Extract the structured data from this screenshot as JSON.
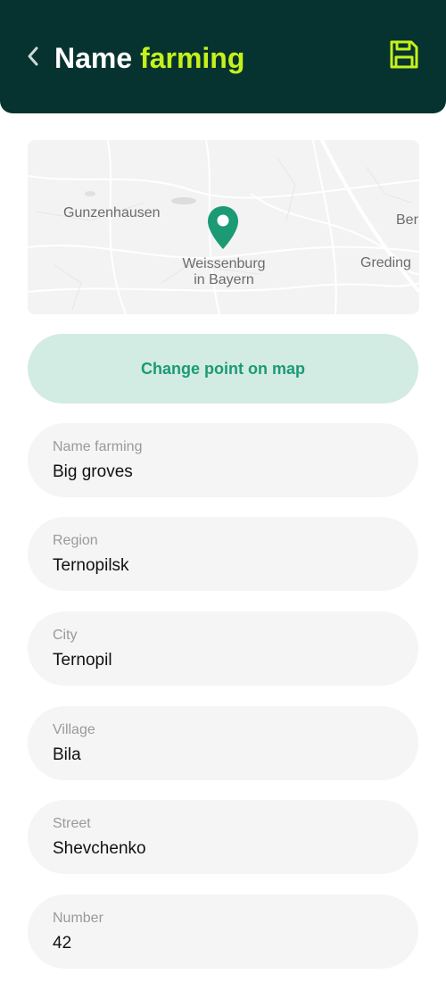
{
  "header": {
    "title_part1": "Name",
    "title_part2": "farming",
    "back_icon": "chevron-left-icon",
    "save_icon": "floppy-disk-icon",
    "bg_color": "#063330",
    "accent_color": "#c6f11a"
  },
  "map": {
    "labels": [
      "Gunzenhausen",
      "Weissenburg\nin Bayern",
      "Greding",
      "Ber"
    ],
    "pin_icon": "map-pin-icon",
    "pin_color": "#1c9a74"
  },
  "change_point_button": {
    "label": "Change point on map",
    "bg_color": "#d2ebe3",
    "text_color": "#1c9a74"
  },
  "fields": [
    {
      "label": "Name farming",
      "value": "Big groves"
    },
    {
      "label": "Region",
      "value": "Ternopilsk"
    },
    {
      "label": "City",
      "value": "Ternopil"
    },
    {
      "label": "Village",
      "value": "Bila"
    },
    {
      "label": "Street",
      "value": "Shevchenko"
    },
    {
      "label": "Number",
      "value": "42"
    }
  ]
}
